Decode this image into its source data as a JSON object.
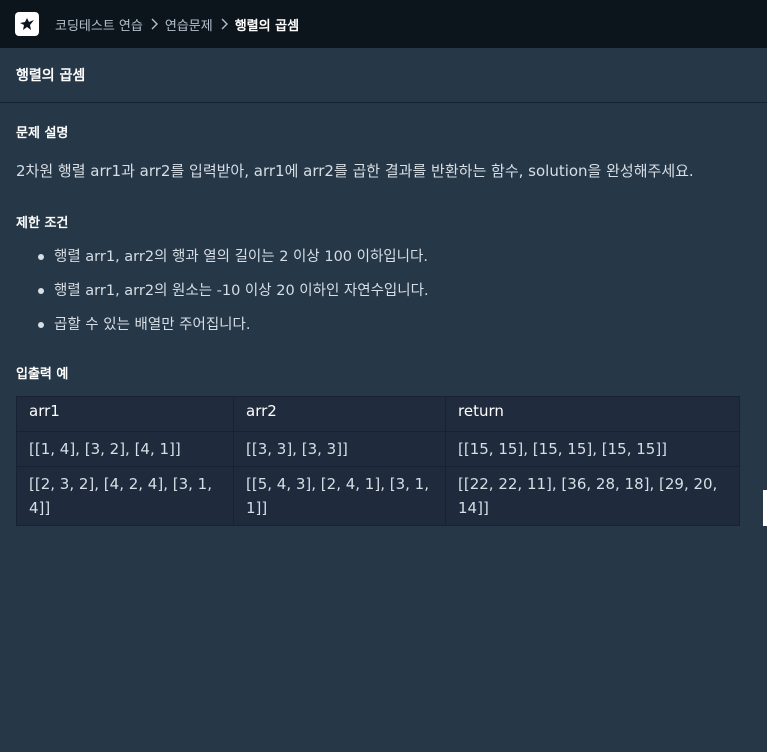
{
  "breadcrumb": {
    "items": [
      "코딩테스트 연습",
      "연습문제"
    ],
    "current": "행렬의 곱셈"
  },
  "page_title": "행렬의 곱셈",
  "problem": {
    "heading": "문제 설명",
    "description": "2차원 행렬 arr1과 arr2를 입력받아, arr1에 arr2를 곱한 결과를 반환하는 함수, solution을 완성해주세요."
  },
  "constraints": {
    "heading": "제한 조건",
    "items": [
      "행렬 arr1, arr2의 행과 열의 길이는 2 이상 100 이하입니다.",
      "행렬 arr1, arr2의 원소는 -10 이상 20 이하인 자연수입니다.",
      "곱할 수 있는 배열만 주어집니다."
    ]
  },
  "examples": {
    "heading": "입출력 예",
    "columns": [
      "arr1",
      "arr2",
      "return"
    ],
    "rows": [
      [
        "[[1, 4], [3, 2], [4, 1]]",
        "[[3, 3], [3, 3]]",
        "[[15, 15], [15, 15], [15, 15]]"
      ],
      [
        "[[2, 3, 2], [4, 2, 4], [3, 1, 4]]",
        "[[5, 4, 3], [2, 4, 1], [3, 1, 1]]",
        "[[22, 22, 11], [36, 28, 18], [29, 20, 14]]"
      ]
    ]
  },
  "icons": {
    "logo": "programmers-logo-icon",
    "separator": "chevron-right-icon"
  }
}
